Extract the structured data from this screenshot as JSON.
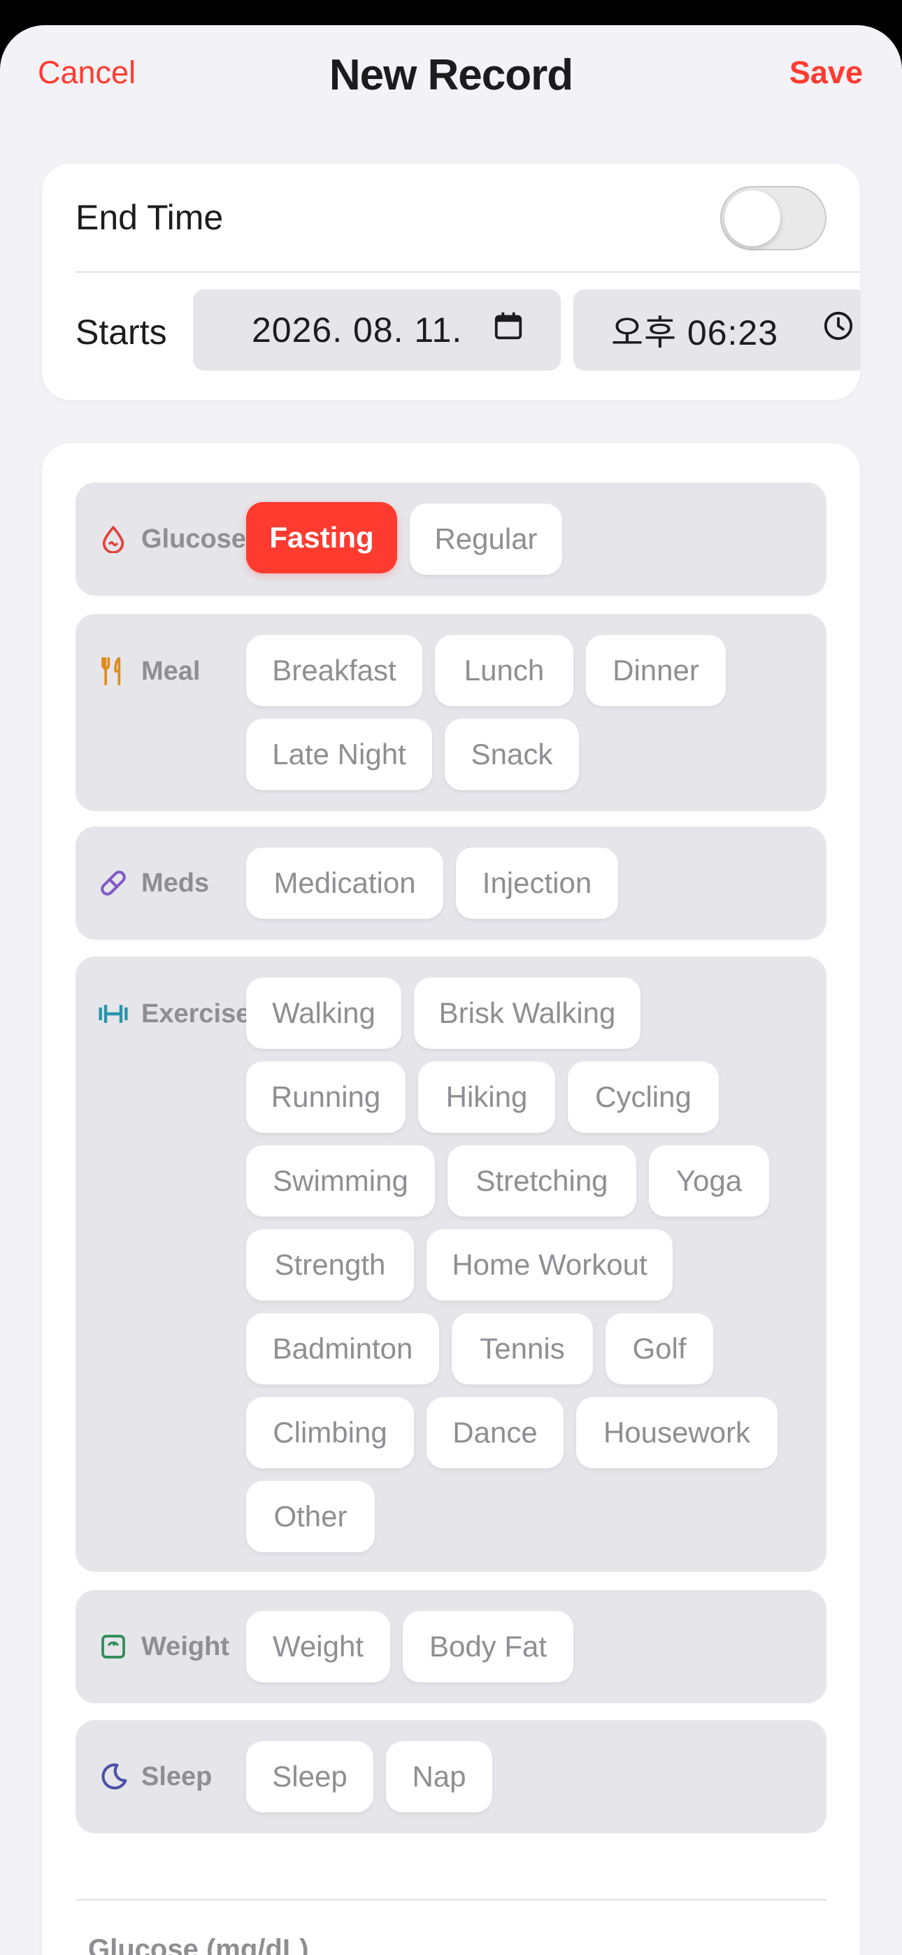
{
  "nav": {
    "cancel": "Cancel",
    "title": "New Record",
    "save": "Save"
  },
  "time": {
    "end_time_label": "End Time",
    "end_time_enabled": false,
    "starts_label": "Starts",
    "date_value": "2026. 08. 11.",
    "time_value": "오후 06:23"
  },
  "categories": {
    "glucose": {
      "label": "Glucose",
      "icon": "drop-icon",
      "color": "#e0413a",
      "chips": [
        "Fasting",
        "Regular"
      ],
      "selected": "Fasting"
    },
    "meal": {
      "label": "Meal",
      "icon": "fork-knife-icon",
      "color": "#e08a1a",
      "chips": [
        "Breakfast",
        "Lunch",
        "Dinner",
        "Late Night",
        "Snack"
      ]
    },
    "meds": {
      "label": "Meds",
      "icon": "pill-icon",
      "color": "#7e5ac6",
      "chips": [
        "Medication",
        "Injection"
      ]
    },
    "exercise": {
      "label": "Exercise",
      "icon": "dumbbell-icon",
      "color": "#2a94a8",
      "chips": [
        "Walking",
        "Brisk Walking",
        "Running",
        "Hiking",
        "Cycling",
        "Swimming",
        "Stretching",
        "Yoga",
        "Strength",
        "Home Workout",
        "Badminton",
        "Tennis",
        "Golf",
        "Climbing",
        "Dance",
        "Housework",
        "Other"
      ]
    },
    "weight": {
      "label": "Weight",
      "icon": "scale-icon",
      "color": "#2e8b57",
      "chips": [
        "Weight",
        "Body Fat"
      ]
    },
    "sleep": {
      "label": "Sleep",
      "icon": "moon-icon",
      "color": "#4b4fa8",
      "chips": [
        "Sleep",
        "Nap"
      ]
    }
  },
  "section": {
    "glucose_unit_label": "Glucose (mg/dL)"
  },
  "colors": {
    "accent": "#ff3b30",
    "chip_text": "#8e8e93",
    "group_bg": "#e5e5ea"
  }
}
